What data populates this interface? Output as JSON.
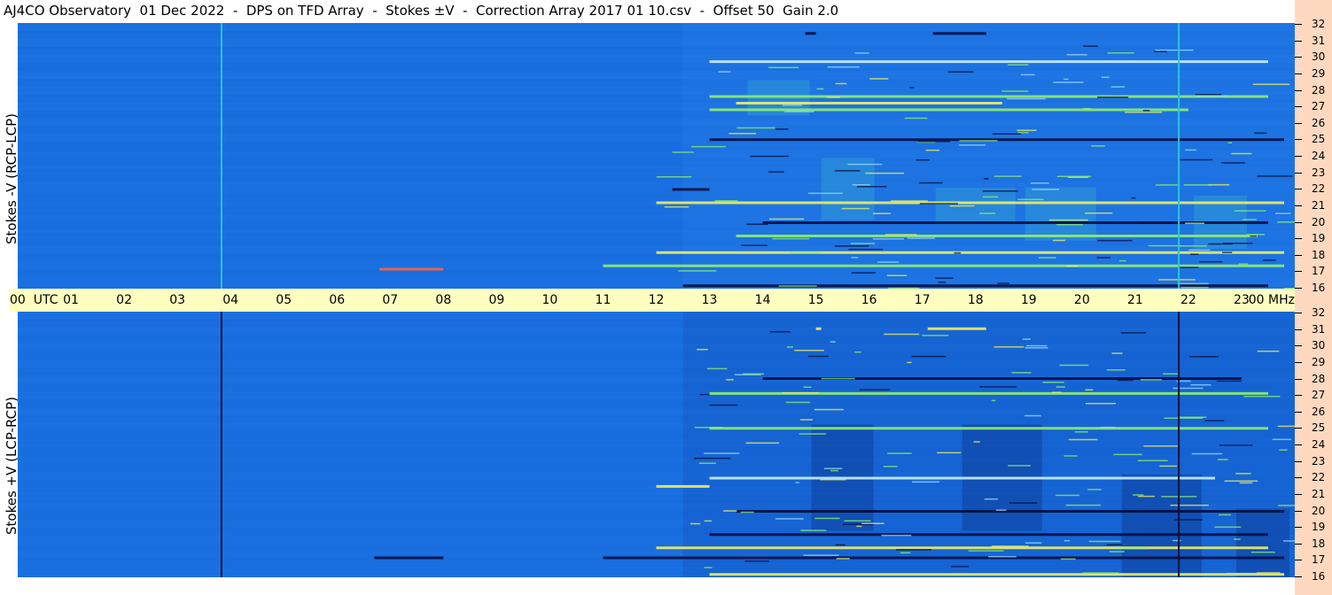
{
  "title": "AJ4CO Observatory  01 Dec 2022  -  DPS on TFD Array  -  Stokes ±V  -  Correction Array 2017 01 10.csv  -  Offset 50  Gain 2.0",
  "colors": {
    "background_blue": "#1a6fe0",
    "axis_band": "#ffffc0",
    "freq_strip": "#ffd9bf",
    "cyan_marker": "#29c6d6",
    "dark_marker": "#0a1238",
    "emission_green": "#8ff06a",
    "emission_yellow": "#f0f060",
    "absorption_dark": "#050d40"
  },
  "chart_data": [
    {
      "type": "heatmap",
      "ylabel": "Stokes -V (RCP-LCP)",
      "ylim": [
        16,
        32
      ],
      "y_ticks": [
        "32",
        "31",
        "30",
        "29",
        "28",
        "27",
        "26",
        "25",
        "24",
        "23",
        "22",
        "21",
        "20",
        "19",
        "18",
        "17",
        "16"
      ],
      "x_ticks": [
        "00  UTC",
        "01",
        "02",
        "03",
        "04",
        "05",
        "06",
        "07",
        "08",
        "09",
        "10",
        "11",
        "12",
        "13",
        "14",
        "15",
        "16",
        "17",
        "18",
        "19",
        "20",
        "21",
        "22",
        "23",
        "00 MHz"
      ],
      "markers_utc": [
        3.83,
        21.82
      ],
      "marker_color": "cyan"
    },
    {
      "type": "heatmap",
      "ylabel": "Stokes +V (LCP-RCP)",
      "ylim": [
        16,
        32
      ],
      "y_ticks": [
        "32",
        "31",
        "30",
        "29",
        "28",
        "27",
        "26",
        "25",
        "24",
        "23",
        "22",
        "21",
        "20",
        "19",
        "18",
        "17",
        "16"
      ],
      "x_ticks": [
        "00  UTC",
        "01",
        "02",
        "03",
        "04",
        "05",
        "06",
        "07",
        "08",
        "09",
        "10",
        "11",
        "12",
        "13",
        "14",
        "15",
        "16",
        "17",
        "18",
        "19",
        "20",
        "21",
        "22",
        "23",
        "00 MHz"
      ],
      "markers_utc": [
        3.83,
        21.82
      ],
      "marker_color": "dark"
    }
  ]
}
